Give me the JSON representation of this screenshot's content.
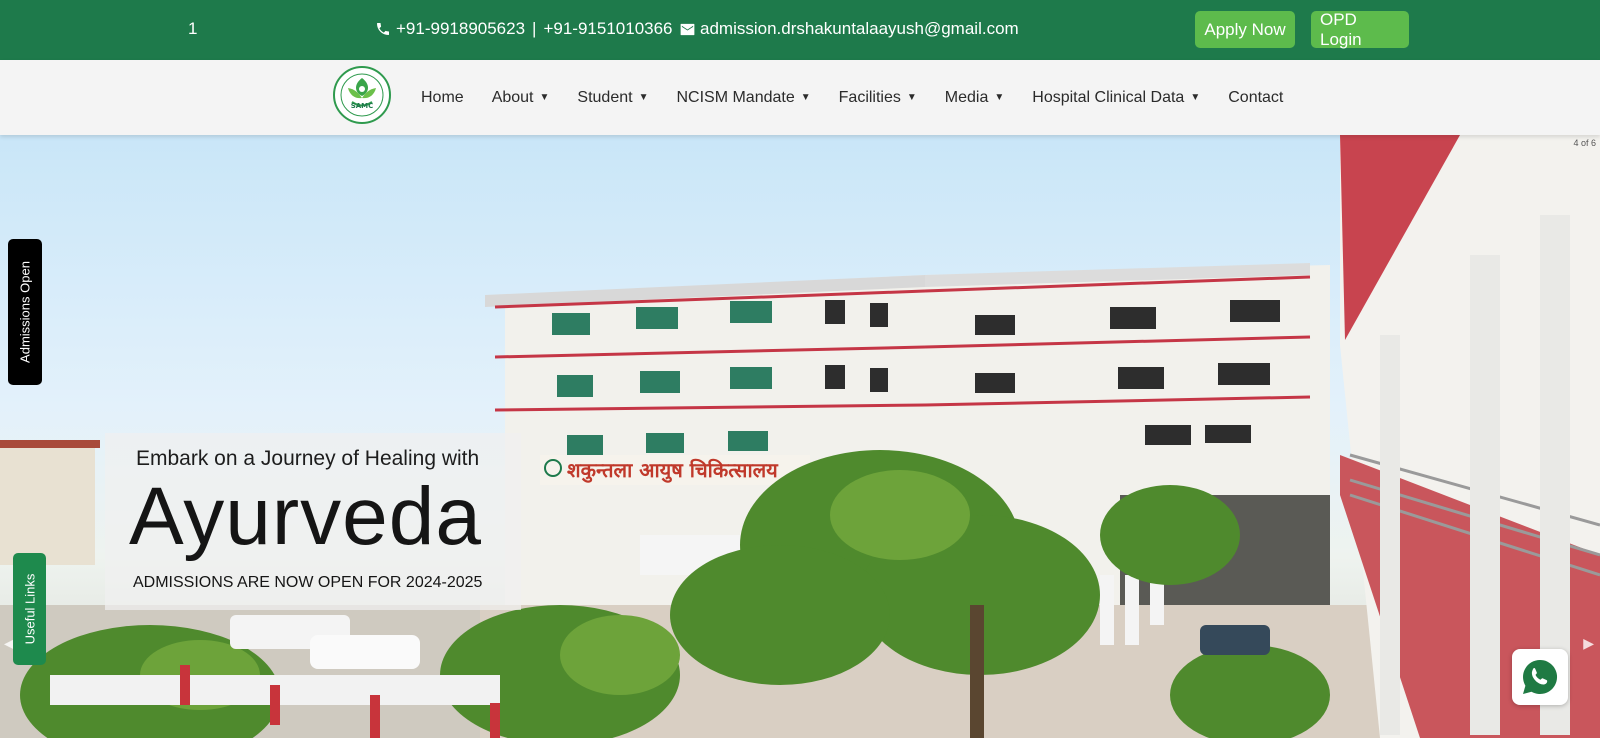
{
  "topbar": {
    "counter": "1",
    "phone_1": "+91-9918905623",
    "separator": "|",
    "phone_2": "+91-9151010366",
    "email": "admission.drshakuntalaayush@gmail.com",
    "apply_label": "Apply Now",
    "opd_label": "OPD Login",
    "background_color": "#1e7a4b",
    "button_color": "#5dbb4c"
  },
  "nav": {
    "logo_text": "SAMC",
    "items": [
      {
        "label": "Home",
        "dropdown": false
      },
      {
        "label": "About",
        "dropdown": true
      },
      {
        "label": "Student",
        "dropdown": true
      },
      {
        "label": "NCISM Mandate",
        "dropdown": true
      },
      {
        "label": "Facilities",
        "dropdown": true
      },
      {
        "label": "Media",
        "dropdown": true
      },
      {
        "label": "Hospital Clinical Data",
        "dropdown": true
      },
      {
        "label": "Contact",
        "dropdown": false
      }
    ]
  },
  "hero": {
    "slide_counter": "4 of 6",
    "caption_pre": "Embark on a Journey of Healing with",
    "caption_big": "Ayurveda",
    "caption_sub": "ADMISSIONS ARE NOW OPEN FOR 2024-2025",
    "building_sign": "शकुन्तला आयुष चिकित्सालय"
  },
  "side_tabs": {
    "admissions": "Admissions Open",
    "useful_links": "Useful Links"
  },
  "icons": {
    "phone": "phone-icon",
    "email": "envelope-icon",
    "whatsapp": "whatsapp-icon",
    "prev": "chevron-left-icon",
    "next": "chevron-right-icon"
  }
}
